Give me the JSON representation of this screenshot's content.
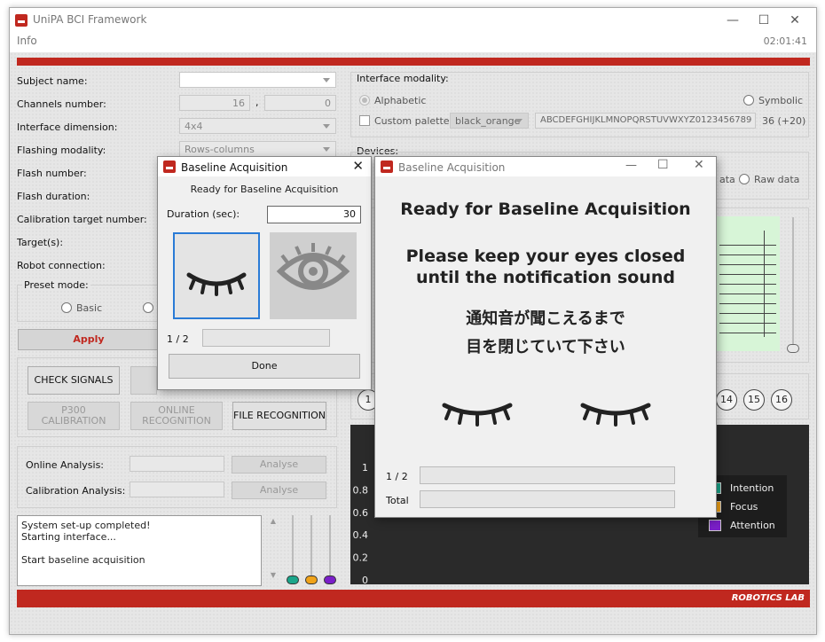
{
  "window": {
    "title": "UniPA BCI Framework",
    "menu_info": "Info",
    "clock": "02:01:41",
    "footer_brand": "ROBOTICS LAB"
  },
  "left": {
    "subject_name_label": "Subject name:",
    "channels_label": "Channels number:",
    "channels_a": "16",
    "channels_sep": ",",
    "channels_b": "0",
    "interface_dim_label": "Interface dimension:",
    "interface_dim_value": "4x4",
    "flashing_label": "Flashing modality:",
    "flashing_value": "Rows-columns",
    "flash_number_label": "Flash number:",
    "flash_duration_label": "Flash duration:",
    "calib_target_label": "Calibration target number:",
    "targets_label": "Target(s):",
    "robot_label": "Robot connection:",
    "preset_label": "Preset mode:",
    "preset_basic": "Basic",
    "apply": "Apply",
    "check_signals": "CHECK SIGNALS",
    "p300_calibration": "P300 CALIBRATION",
    "online_recognition": "ONLINE RECOGNITION",
    "file_recognition": "FILE RECOGNITION",
    "online_analysis_label": "Online Analysis:",
    "calibration_analysis_label": "Calibration Analysis:",
    "analyse": "Analyse",
    "log": [
      "System set-up completed!",
      "Starting interface...",
      "",
      "Start baseline acquisition"
    ]
  },
  "right": {
    "interface_modality_label": "Interface modality:",
    "alphabetic": "Alphabetic",
    "symbolic": "Symbolic",
    "custom_palette": "Custom palette",
    "palette_value": "black_orange",
    "alphabet": "ABCDEFGHIJKLMNOPQRSTUVWXYZ0123456789",
    "alphabet_count": "36 (+20)",
    "devices_label": "Devices:",
    "data_partial": "ata",
    "raw_data": "Raw data",
    "targets": [
      "14",
      "15",
      "16"
    ],
    "chart_legend": [
      {
        "name": "Intention",
        "color": "#1aa58a"
      },
      {
        "name": "Focus",
        "color": "#f0a31a"
      },
      {
        "name": "Attention",
        "color": "#7b1fc9"
      }
    ]
  },
  "chart_data": {
    "type": "line",
    "yticks": [
      "1",
      "0.8",
      "0.6",
      "0.4",
      "0.2",
      "0"
    ],
    "ylim": [
      0,
      1
    ],
    "series": [
      {
        "name": "Intention",
        "values": []
      },
      {
        "name": "Focus",
        "values": []
      },
      {
        "name": "Attention",
        "values": []
      }
    ]
  },
  "dialog_small": {
    "title": "Baseline Acquisition",
    "header": "Ready for Baseline Acquisition",
    "duration_label": "Duration (sec):",
    "duration_value": "30",
    "progress_label": "1 / 2",
    "done": "Done"
  },
  "dialog_big": {
    "title": "Baseline Acquisition",
    "heading": "Ready for Baseline Acquisition",
    "line1": "Please keep your eyes closed",
    "line2": "until the notification sound",
    "jp1": "通知音が聞こえるまで",
    "jp2": "目を閉じていて下さい",
    "step_label": "1 / 2",
    "total_label": "Total"
  }
}
